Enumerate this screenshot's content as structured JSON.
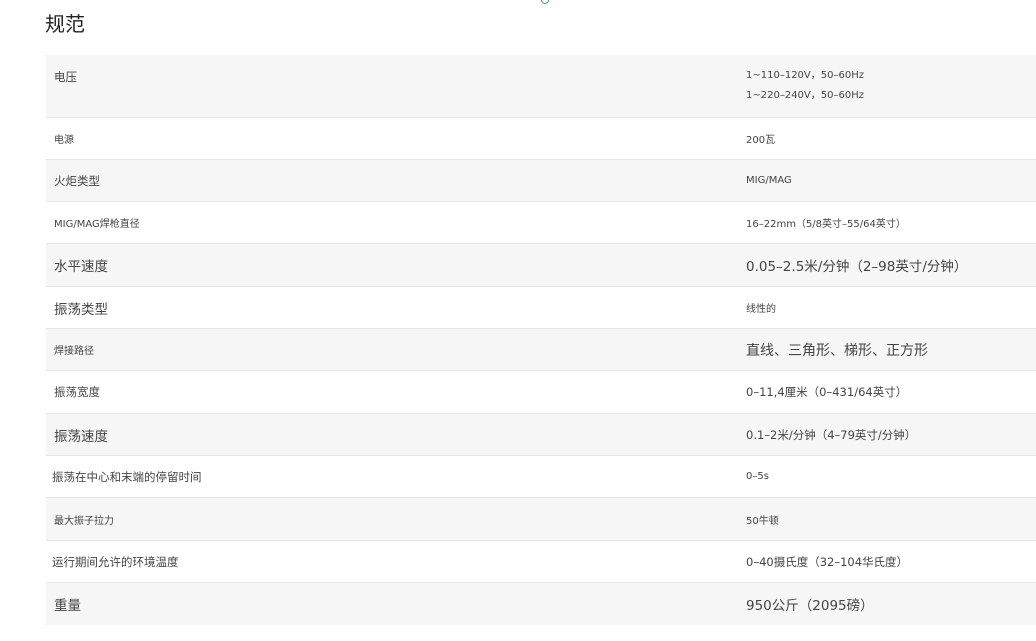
{
  "page": {
    "title": "规范"
  },
  "specs": [
    {
      "label": "电压",
      "values": [
        "1~110–120V，50–60Hz",
        "1~220–240V，50–60Hz"
      ]
    },
    {
      "label": "电源",
      "values": [
        "200瓦"
      ]
    },
    {
      "label": "火炬类型",
      "values": [
        "MIG/MAG"
      ]
    },
    {
      "label": "MIG/MAG焊枪直径",
      "values": [
        "16–22mm（5/8英寸–55/64英寸）"
      ]
    },
    {
      "label": "水平速度",
      "values": [
        "0.05–2.5米/分钟（2–98英寸/分钟）"
      ]
    },
    {
      "label": "振荡类型",
      "values": [
        "线性的"
      ]
    },
    {
      "label": "焊接路径",
      "values": [
        "直线、三角形、梯形、正方形"
      ]
    },
    {
      "label": "振荡宽度",
      "values": [
        "0–11,4厘米（0–431/64英寸）"
      ]
    },
    {
      "label": "振荡速度",
      "values": [
        "0.1–2米/分钟（4–79英寸/分钟）"
      ]
    },
    {
      "label": "振荡在中心和末端的停留时间",
      "values": [
        "0–5s"
      ]
    },
    {
      "label": "最大振子拉力",
      "values": [
        "50牛顿"
      ]
    },
    {
      "label": "运行期间允许的环境温度",
      "values": [
        "0–40摄氏度（32–104华氏度）"
      ]
    },
    {
      "label": "重量",
      "values": [
        "950公斤（2095磅）"
      ]
    }
  ]
}
